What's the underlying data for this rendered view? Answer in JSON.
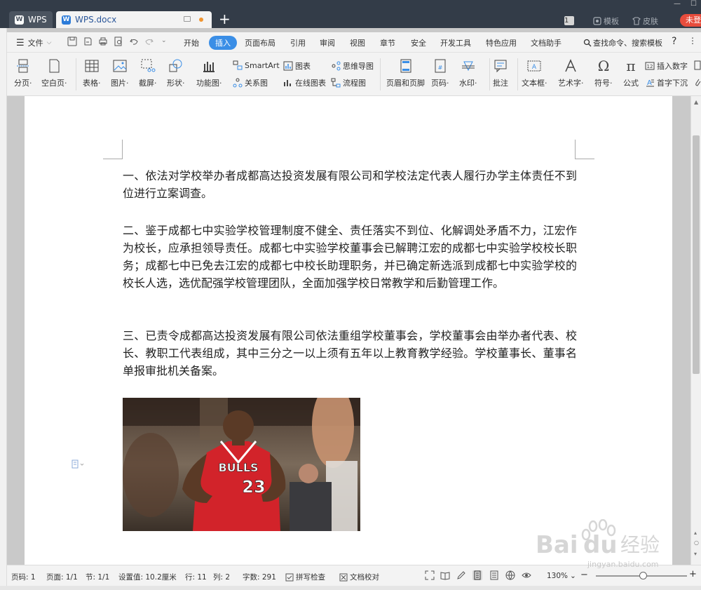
{
  "titlebar": {
    "home_tab": "WPS",
    "doc_tab": "WPS.docx",
    "new_tab": "+",
    "badge": "1",
    "templates": "模板",
    "skin": "皮肤",
    "login": "未登"
  },
  "menu": {
    "file": "文件",
    "items": [
      "开始",
      "插入",
      "页面布局",
      "引用",
      "审阅",
      "视图",
      "章节",
      "安全",
      "开发工具",
      "特色应用",
      "文档助手"
    ],
    "search": "查找命令、搜索模板",
    "help": "?"
  },
  "ribbon": {
    "page_break": "分页",
    "blank_page": "空白页",
    "table": "表格",
    "picture": "图片",
    "screenshot": "截屏",
    "shape": "形状",
    "function_chart": "功能图",
    "smartart": "SmartArt",
    "chart": "图表",
    "mindmap": "思维导图",
    "relation": "关系图",
    "online_chart": "在线图表",
    "flowchart": "流程图",
    "header_footer": "页眉和页脚",
    "page_number": "页码",
    "watermark": "水印",
    "comment": "批注",
    "textbox": "文本框",
    "wordart": "艺术字",
    "symbol": "符号",
    "formula": "公式",
    "insert_number": "插入数字",
    "drop_cap": "首字下沉"
  },
  "document": {
    "para1": "一、依法对学校举办者成都高达投资发展有限公司和学校法定代表人履行办学主体责任不到位进行立案调查。",
    "para2": "二、鉴于成都七中实验学校管理制度不健全、责任落实不到位、化解调处矛盾不力，江宏作为校长，应承担领导责任。成都七中实验学校董事会已解聘江宏的成都七中实验学校校长职务；成都七中已免去江宏的成都七中校长助理职务，并已确定新选派到成都七中实验学校的校长人选，选优配强学校管理团队，全面加强学校日常教学和后勤管理工作。",
    "para3": "三、已责令成都高达投资发展有限公司依法重组学校董事会，学校董事会由举办者代表、校长、教职工代表组成，其中三分之一以上须有五年以上教育教学经验。学校董事长、董事名单报审批机关备案。",
    "jersey_team": "BULLS",
    "jersey_number": "23"
  },
  "status": {
    "page_code": "页码: 1",
    "page": "页面: 1/1",
    "section": "节: 1/1",
    "setting": "设置值: 10.2厘米",
    "row": "行: 11",
    "col": "列: 2",
    "chars": "字数: 291",
    "spell": "拼写检查",
    "proof": "文档校对",
    "zoom": "130%",
    "zoom_fraction": 0.52
  },
  "watermark": {
    "brand": "Bai",
    "brand2": "du",
    "jingyan": "经验",
    "url": "jingyan.baidu.com"
  },
  "colors": {
    "accent": "#3a8ee6",
    "titlebar": "#333c48",
    "login": "#e74c3c",
    "jersey": "#d2232a"
  }
}
